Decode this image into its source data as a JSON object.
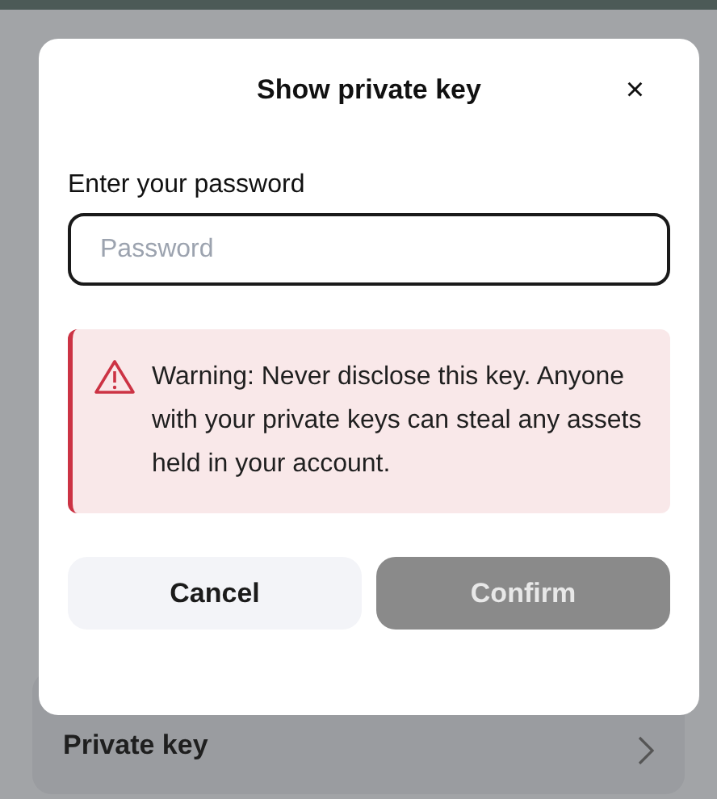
{
  "background": {
    "row": {
      "label": "Private key"
    }
  },
  "dialog": {
    "title": "Show private key",
    "close": "×",
    "field": {
      "label": "Enter your password",
      "placeholder": "Password"
    },
    "warning": {
      "text": "Warning: Never disclose this key. Anyone with your private keys can steal any assets held in your account."
    },
    "buttons": [
      {
        "label": "Cancel",
        "kind": "secondary",
        "disabled": false
      },
      {
        "label": "Confirm",
        "kind": "primary",
        "disabled": true
      }
    ]
  }
}
